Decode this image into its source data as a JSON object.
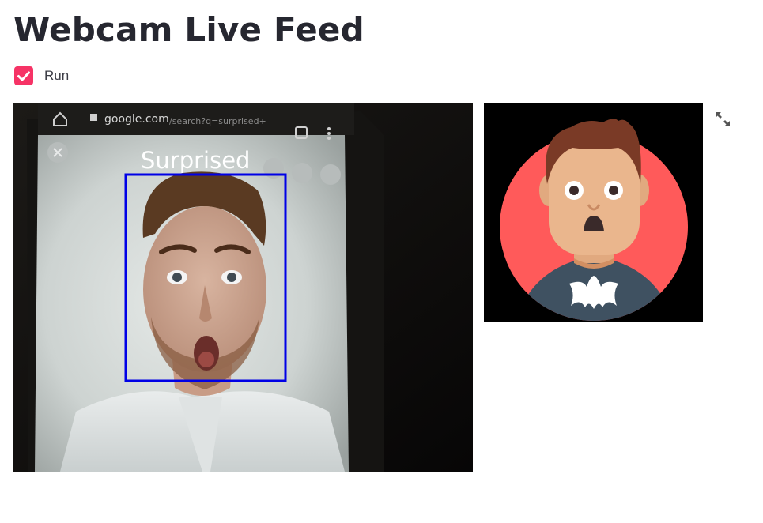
{
  "header": {
    "title": "Webcam Live Feed"
  },
  "controls": {
    "run_checkbox_label": "Run",
    "run_checked": true
  },
  "webcam": {
    "emotion_label": "Surprised",
    "browser_address": "google.com",
    "browser_path": "/search?q=surprised+",
    "detection_box_color": "#0000e6"
  },
  "emoji": {
    "expression": "surprised",
    "badge_color": "#ff5a5a"
  },
  "icons": {
    "checkbox": "check-icon",
    "fullscreen": "expand-icon"
  },
  "colors": {
    "accent": "#f63366",
    "title": "#262730"
  }
}
